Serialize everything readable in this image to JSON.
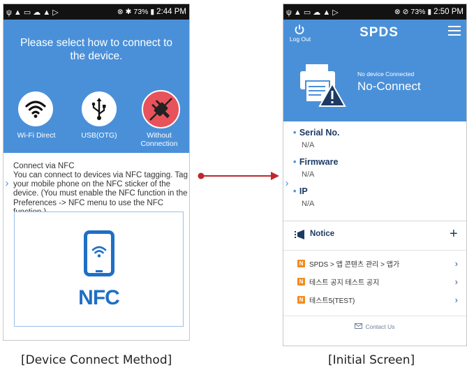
{
  "left": {
    "status": {
      "battery": "73%",
      "time": "2:44 PM"
    },
    "title": "Please select how to connect to the device.",
    "options": [
      {
        "label": "Wi-Fi Direct",
        "icon": "wifi-icon"
      },
      {
        "label": "USB(OTG)",
        "icon": "usb-icon"
      },
      {
        "label": "Without Connection",
        "icon": "plug-icon"
      }
    ],
    "nfc_heading": "Connect via NFC",
    "nfc_body": "You can connect to devices via NFC tagging. Tag your mobile phone on the NFC sticker of the device. (You must enable the NFC function in the Preferences -> NFC menu to use the NFC function.)",
    "nfc_label": "NFC"
  },
  "right": {
    "status": {
      "battery": "73%",
      "time": "2:50 PM"
    },
    "logout_label": "Log Out",
    "logo": "SPDS",
    "device_status_small": "No device Connected",
    "device_status_big": "No-Connect",
    "info": [
      {
        "key": "Serial No.",
        "value": "N/A"
      },
      {
        "key": "Firmware",
        "value": "N/A"
      },
      {
        "key": "IP",
        "value": "N/A"
      }
    ],
    "notice_title": "Notice",
    "notices": [
      {
        "badge": "N",
        "text": "SPDS > 앱 콘텐츠 관리 > 앱가"
      },
      {
        "badge": "N",
        "text": "테스트 공지 테스트 공지"
      },
      {
        "badge": "N",
        "text": "테스트5(TEST)"
      }
    ],
    "contact_label": "Contact Us"
  },
  "captions": {
    "left": "[Device Connect Method]",
    "right": "[Initial Screen]"
  },
  "colors": {
    "primary_blue": "#4a90d9",
    "dark_blue": "#1d3a63",
    "alert_red": "#e8525b",
    "badge_orange": "#f08c21",
    "arrow_red": "#c0262d"
  }
}
